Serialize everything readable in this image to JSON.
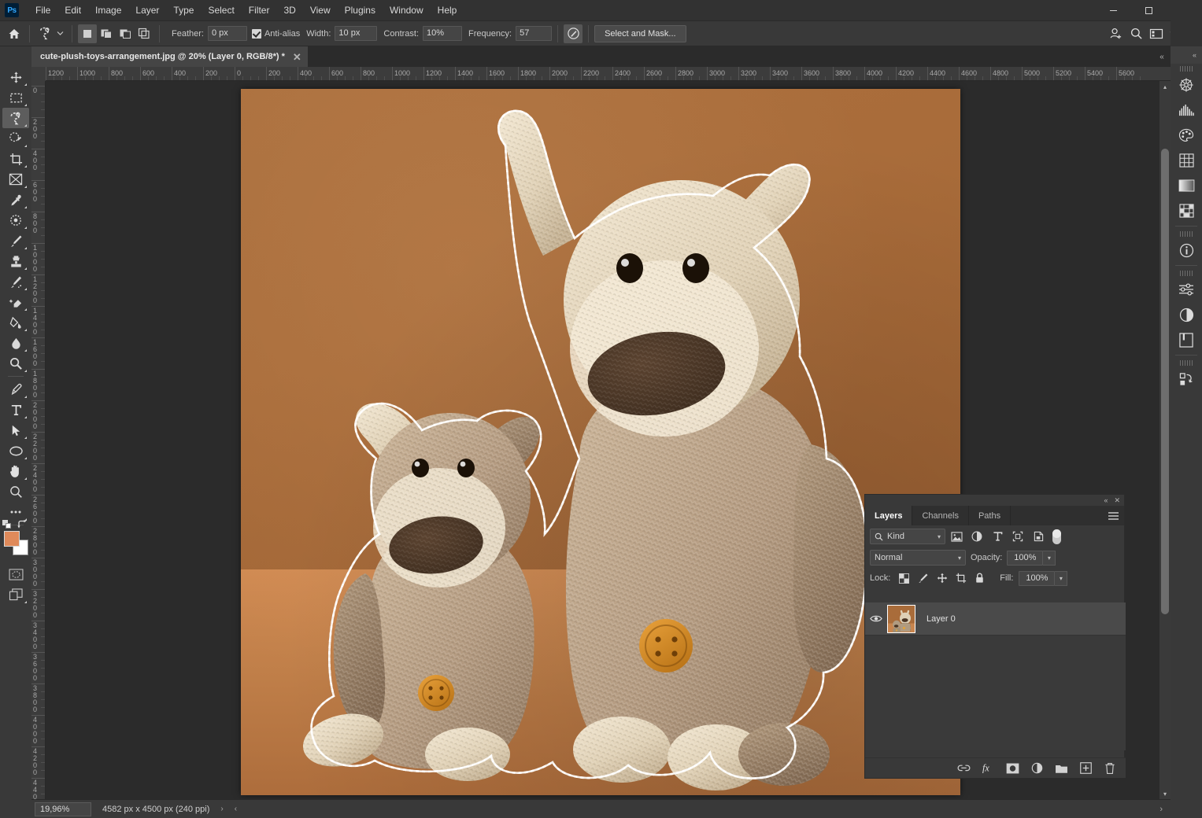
{
  "app": {
    "name": "Photoshop",
    "logo_text": "Ps"
  },
  "menubar": {
    "items": [
      {
        "label": "File"
      },
      {
        "label": "Edit"
      },
      {
        "label": "Image"
      },
      {
        "label": "Layer"
      },
      {
        "label": "Type"
      },
      {
        "label": "Select"
      },
      {
        "label": "Filter"
      },
      {
        "label": "3D"
      },
      {
        "label": "View"
      },
      {
        "label": "Plugins"
      },
      {
        "label": "Window"
      },
      {
        "label": "Help"
      }
    ],
    "window_controls": {
      "minimize": "—",
      "maximize": "▭",
      "close": "✕"
    }
  },
  "options_bar": {
    "home_icon": "home-icon",
    "tool_preset_icon": "magnetic-lasso-icon",
    "selection_modes": [
      "new-selection",
      "add-to-selection",
      "subtract-from-selection",
      "intersect-with-selection"
    ],
    "feather_label": "Feather:",
    "feather_value": "0 px",
    "antialias_label": "Anti-alias",
    "antialias_checked": true,
    "width_label": "Width:",
    "width_value": "10 px",
    "contrast_label": "Contrast:",
    "contrast_value": "10%",
    "frequency_label": "Frequency:",
    "frequency_value": "57",
    "pressure_icon": "pen-pressure-icon",
    "select_and_mask_label": "Select and Mask...",
    "right_icons": [
      "user-add-icon",
      "search-icon",
      "workspace-icon",
      "chevron-down-icon",
      "share-icon"
    ]
  },
  "document": {
    "tab_title": "cute-plush-toys-arrangement.jpg @ 20% (Layer 0, RGB/8*) *",
    "close_glyph": "✕"
  },
  "toolbar": {
    "tools": [
      {
        "name": "move-tool",
        "active": false
      },
      {
        "name": "rectangular-marquee-tool",
        "active": false
      },
      {
        "name": "magnetic-lasso-tool",
        "active": true
      },
      {
        "name": "object-selection-tool",
        "active": false
      },
      {
        "name": "crop-tool",
        "active": false
      },
      {
        "name": "frame-tool",
        "active": false
      },
      {
        "name": "eyedropper-tool",
        "active": false
      },
      {
        "name": "spot-healing-brush-tool",
        "active": false
      },
      {
        "name": "brush-tool",
        "active": false
      },
      {
        "name": "clone-stamp-tool",
        "active": false
      },
      {
        "name": "history-brush-tool",
        "active": false
      },
      {
        "name": "eraser-tool",
        "active": false
      },
      {
        "name": "gradient-tool",
        "active": false
      },
      {
        "name": "blur-tool",
        "active": false
      },
      {
        "name": "dodge-tool",
        "active": false
      },
      {
        "name": "pen-tool",
        "active": false
      },
      {
        "name": "horizontal-type-tool",
        "active": false
      },
      {
        "name": "path-selection-tool",
        "active": false
      },
      {
        "name": "ellipse-tool",
        "active": false
      },
      {
        "name": "hand-tool",
        "active": false
      },
      {
        "name": "zoom-tool",
        "active": false
      },
      {
        "name": "edit-toolbar-tool",
        "active": false
      }
    ],
    "foreground_color": "#e08a5a",
    "background_color": "#ffffff",
    "quick_mask_icon": "quick-mask-icon",
    "screen_mode_icon": "screen-mode-icon"
  },
  "rulers": {
    "unit": "px",
    "horizontal_labels": [
      "1200",
      "1000",
      "800",
      "600",
      "400",
      "200",
      "0",
      "200",
      "400",
      "600",
      "800",
      "1000",
      "1200",
      "1400",
      "1600",
      "1800",
      "2000",
      "2200",
      "2400",
      "2600",
      "2800",
      "3000",
      "3200",
      "3400",
      "3600",
      "3800",
      "4000",
      "4200",
      "4400",
      "4600",
      "4800",
      "5000",
      "5200",
      "5400",
      "5600"
    ],
    "vertical_labels": [
      "0",
      "200",
      "400",
      "600",
      "800",
      "1000",
      "1200",
      "1400",
      "1600",
      "1800",
      "2000",
      "2200",
      "2400",
      "2600",
      "2800",
      "3000",
      "3200",
      "3400",
      "3600",
      "3800",
      "4000",
      "4200",
      "4400"
    ]
  },
  "canvas": {
    "image_description": "two crochet plush dog toys on brown background with active marching-ants selection",
    "background_wall_color": "#a96c3a",
    "floor_color": "#c8854e",
    "selection_active": true
  },
  "layers_panel": {
    "collapse_glyph": "«",
    "close_glyph": "✕",
    "tabs": [
      {
        "label": "Layers",
        "active": true
      },
      {
        "label": "Channels",
        "active": false
      },
      {
        "label": "Paths",
        "active": false
      }
    ],
    "menu_icon": "panel-menu-icon",
    "filter": {
      "search_icon": "search-icon",
      "kind_label": "Kind",
      "caret": "⌄",
      "icons": [
        "filter-pixel-icon",
        "filter-adjustment-icon",
        "filter-type-icon",
        "filter-shape-icon",
        "filter-smart-object-icon"
      ],
      "toggle_name": "filter-enable-toggle"
    },
    "blend": {
      "mode": "Normal",
      "caret": "⌄",
      "opacity_label": "Opacity:",
      "opacity_value": "100%"
    },
    "lock": {
      "label": "Lock:",
      "icons": [
        "lock-transparent-pixels-icon",
        "lock-image-pixels-icon",
        "lock-position-icon",
        "lock-artboard-nesting-icon",
        "lock-all-icon"
      ],
      "fill_label": "Fill:",
      "fill_value": "100%"
    },
    "layers": [
      {
        "name": "Layer 0",
        "visible": true,
        "selected": true
      }
    ],
    "footer_icons": [
      "link-layers-icon",
      "layer-style-fx-icon",
      "add-layer-mask-icon",
      "new-adjustment-layer-icon",
      "new-group-icon",
      "new-layer-icon",
      "delete-layer-icon"
    ]
  },
  "right_dock": {
    "icons": [
      "color-wheel-icon",
      "histogram-icon",
      "swatches-icon",
      "character-grid-icon",
      "gradients-icon",
      "patterns-icon",
      "info-icon",
      "adjustments-icon",
      "adjustment-layer-icon",
      "libraries-icon",
      "actions-icon"
    ],
    "collapse_glyph": "«"
  },
  "status_bar": {
    "zoom_value": "19,96%",
    "doc_info": "4582 px x 4500 px (240 ppi)",
    "expand_glyph": "›",
    "left_arrow_glyph": "‹"
  }
}
